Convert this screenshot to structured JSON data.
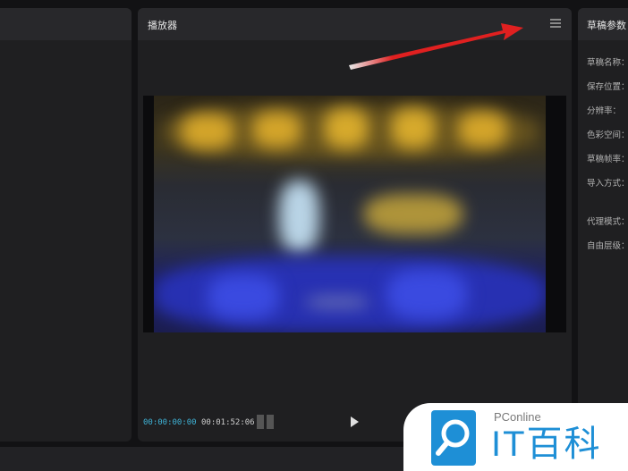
{
  "player": {
    "title": "播放器",
    "menu_icon": "hamburger-menu-icon",
    "current_time": "00:00:00:00",
    "total_time": "00:01:52:06",
    "ratio_icon": "aspect-ratio-icon",
    "play_icon": "play-icon",
    "accent_color": "#3fb4d8"
  },
  "params": {
    "title": "草稿参数",
    "labels": [
      "草稿名称：",
      "保存位置：",
      "分辨率：",
      "色彩空间：",
      "草稿帧率：",
      "导入方式：",
      "代理模式：",
      "自由层级："
    ]
  },
  "annotation": {
    "arrow_color": "#e02020"
  },
  "watermark": {
    "small_text": "PConline",
    "big_text": "IT百科",
    "brand_color": "#1e8fd6"
  }
}
